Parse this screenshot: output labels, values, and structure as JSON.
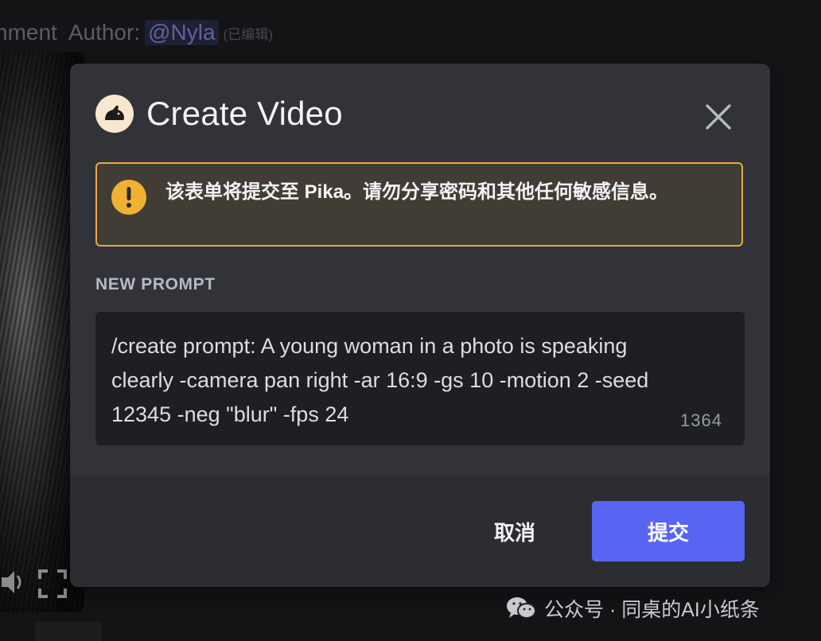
{
  "background": {
    "header_fragment": "hment",
    "author_label": "Author:",
    "mention": "@Nyla",
    "edited_tag": "(已编辑)"
  },
  "modal": {
    "title": "Create Video",
    "logo_icon": "pika-rabbit-icon",
    "close_icon": "close-icon",
    "warning": {
      "icon": "exclamation-icon",
      "text": "该表单将提交至 Pika。请勿分享密码和其他任何敏感信息。"
    },
    "field": {
      "label": "NEW PROMPT",
      "value": "/create prompt: A young woman in a photo is speaking clearly -camera pan right -ar 16:9 -gs 10 -motion 2 -seed 12345 -neg \"blur\" -fps 24",
      "remaining_chars": "1364"
    },
    "buttons": {
      "cancel": "取消",
      "submit": "提交"
    }
  },
  "watermark": {
    "text": "公众号 · 同桌的AI小纸条"
  },
  "colors": {
    "accent": "#5865f2",
    "warning_border": "#e8a84a",
    "warning_icon": "#f0b232",
    "modal_bg": "#313338",
    "footer_bg": "#2b2d31",
    "input_bg": "#1e1f22"
  }
}
